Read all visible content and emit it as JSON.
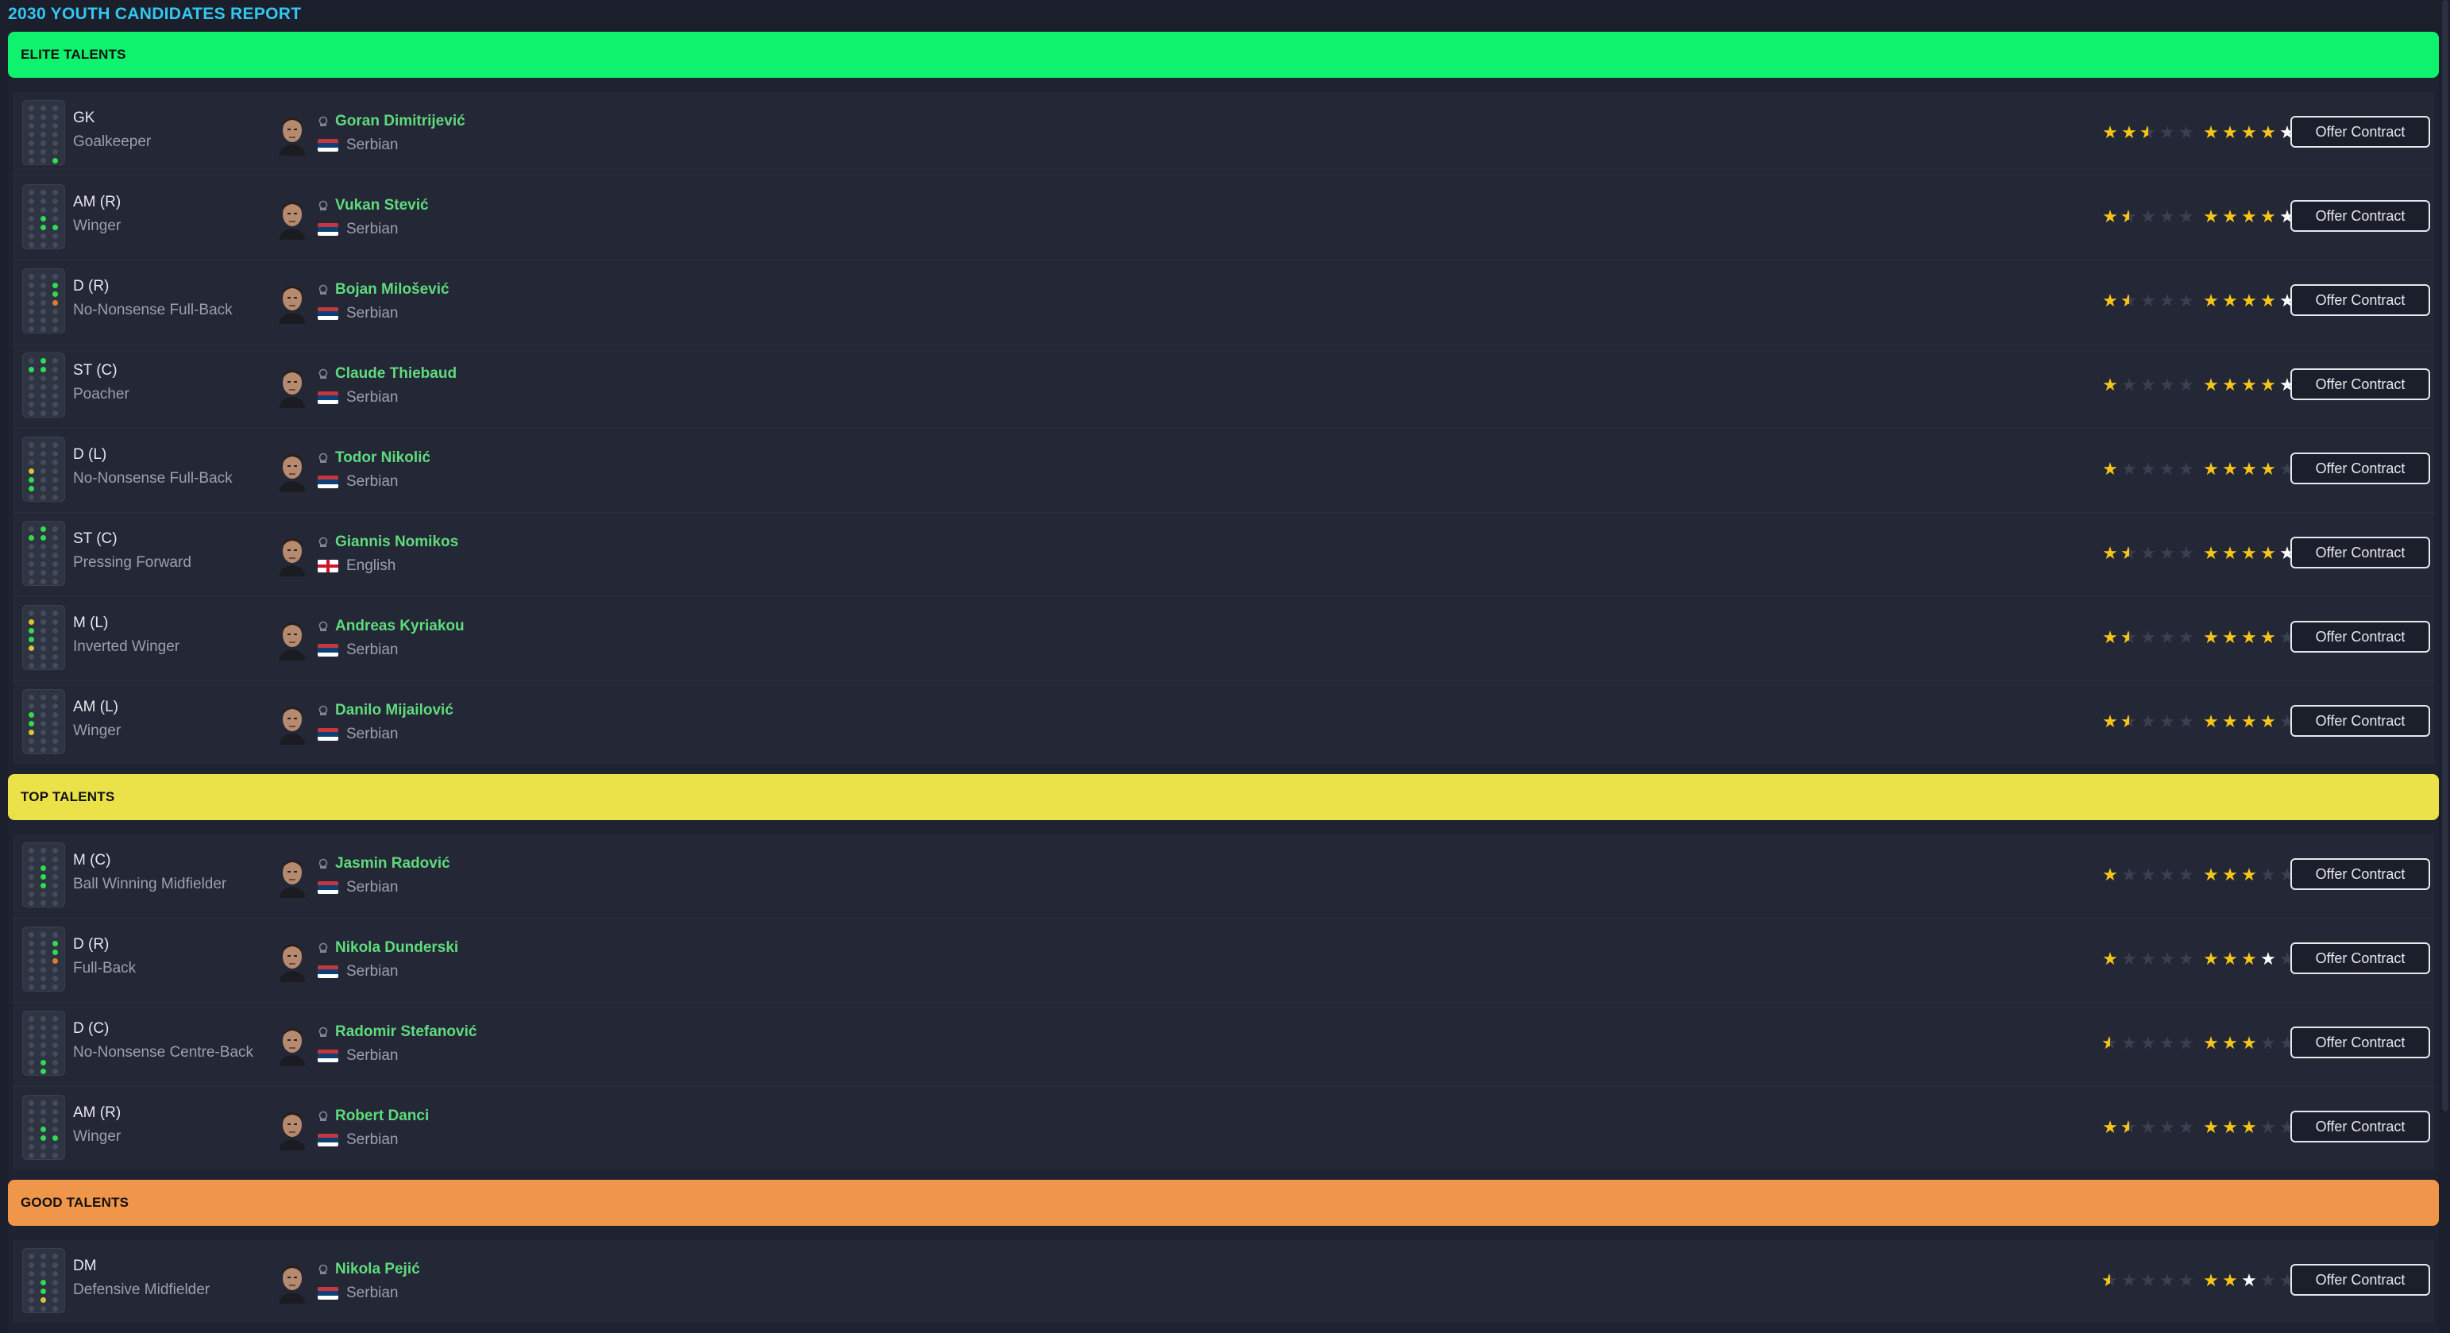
{
  "title": "2030 YOUTH CANDIDATES REPORT",
  "button_label": "Offer Contract",
  "sections": [
    {
      "label": "ELITE TALENTS",
      "color": "#0ef26e",
      "players": [
        {
          "pos": "GK",
          "role": "Goalkeeper",
          "name": "Goran Dimitrijević",
          "nat": "Serbian",
          "flag": "serbia",
          "ca": 2.5,
          "pa": 5,
          "pa_white": 1
        },
        {
          "pos": "AM (R)",
          "role": "Winger",
          "name": "Vukan Stević",
          "nat": "Serbian",
          "flag": "serbia",
          "ca": 1.5,
          "pa": 5,
          "pa_white": 1
        },
        {
          "pos": "D (R)",
          "role": "No-Nonsense Full-Back",
          "name": "Bojan Milošević",
          "nat": "Serbian",
          "flag": "serbia",
          "ca": 1.5,
          "pa": 5,
          "pa_white": 1
        },
        {
          "pos": "ST (C)",
          "role": "Poacher",
          "name": "Claude Thiebaud",
          "nat": "Serbian",
          "flag": "serbia",
          "ca": 1,
          "pa": 5,
          "pa_white": 1
        },
        {
          "pos": "D (L)",
          "role": "No-Nonsense Full-Back",
          "name": "Todor Nikolić",
          "nat": "Serbian",
          "flag": "serbia",
          "ca": 1,
          "pa": 4.5,
          "pa_white": 0.5
        },
        {
          "pos": "ST (C)",
          "role": "Pressing Forward",
          "name": "Giannis Nomikos",
          "nat": "English",
          "flag": "england",
          "ca": 1.5,
          "pa": 5,
          "pa_white": 1
        },
        {
          "pos": "M (L)",
          "role": "Inverted Winger",
          "name": "Andreas Kyriakou",
          "nat": "Serbian",
          "flag": "serbia",
          "ca": 1.5,
          "pa": 4.5,
          "pa_white": 0.5
        },
        {
          "pos": "AM (L)",
          "role": "Winger",
          "name": "Danilo Mijailović",
          "nat": "Serbian",
          "flag": "serbia",
          "ca": 1.5,
          "pa": 4.5,
          "pa_white": 0.5
        }
      ]
    },
    {
      "label": "TOP TALENTS",
      "color": "#ebe24a",
      "players": [
        {
          "pos": "M (C)",
          "role": "Ball Winning Midfielder",
          "name": "Jasmin Radović",
          "nat": "Serbian",
          "flag": "serbia",
          "ca": 1,
          "pa": 3.5,
          "pa_white": 0.5
        },
        {
          "pos": "D (R)",
          "role": "Full-Back",
          "name": "Nikola Dunderski",
          "nat": "Serbian",
          "flag": "serbia",
          "ca": 1,
          "pa": 4,
          "pa_white": 1
        },
        {
          "pos": "D (C)",
          "role": "No-Nonsense Centre-Back",
          "name": "Radomir Stefanović",
          "nat": "Serbian",
          "flag": "serbia",
          "ca": 0.5,
          "pa": 3.5,
          "pa_white": 0.5
        },
        {
          "pos": "AM (R)",
          "role": "Winger",
          "name": "Robert Danci",
          "nat": "Serbian",
          "flag": "serbia",
          "ca": 1.5,
          "pa": 3.5,
          "pa_white": 0.5
        }
      ]
    },
    {
      "label": "GOOD TALENTS",
      "color": "#f0964a",
      "players": [
        {
          "pos": "DM",
          "role": "Defensive Midfielder",
          "name": "Nikola Pejić",
          "nat": "Serbian",
          "flag": "serbia",
          "ca": 0.5,
          "pa": 3,
          "pa_white": 1
        }
      ]
    }
  ]
}
